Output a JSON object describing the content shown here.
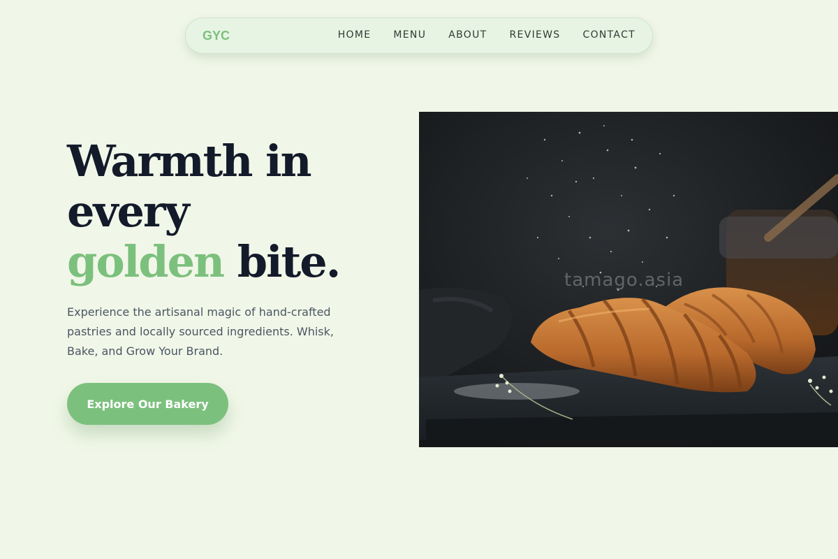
{
  "nav": {
    "logo": "GYC",
    "links": [
      "HOME",
      "MENU",
      "ABOUT",
      "REVIEWS",
      "CONTACT"
    ]
  },
  "hero": {
    "headline_line1": "Warmth in",
    "headline_line2": "every",
    "headline_accent": "golden",
    "headline_end": " bite.",
    "subtitle": "Experience the artisanal magic of hand-crafted pastries and locally sourced ingredients. Whisk, Bake, and Grow Your Brand.",
    "cta_label": "Explore Our Bakery",
    "image_watermark": "tamago.asia"
  },
  "colors": {
    "background": "#f1f7e8",
    "accent": "#7cc07d",
    "heading": "#131a2a",
    "body_text": "#4b5563"
  }
}
